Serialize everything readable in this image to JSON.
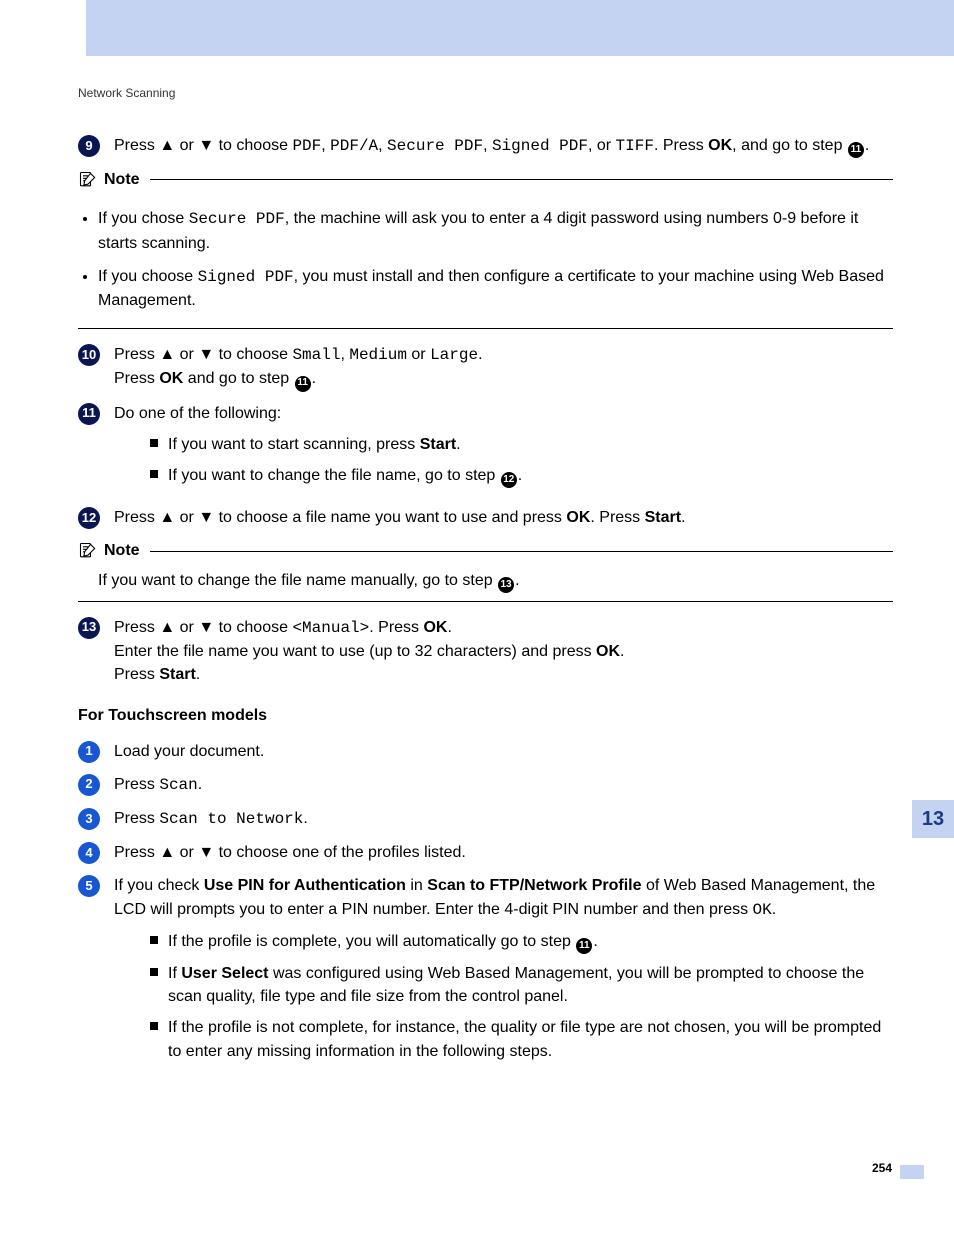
{
  "running_head": "Network Scanning",
  "chapter_tab": "13",
  "page_number": "254",
  "step9": {
    "num": "9",
    "pre1": "Press ",
    "up": "▲",
    "or1": " or ",
    "down": "▼",
    "mid": " to choose ",
    "opt1": "PDF",
    "c1": ", ",
    "opt2": "PDF/A",
    "c2": ", ",
    "opt3": "Secure PDF",
    "c3": ", ",
    "opt4": "Signed PDF",
    "c4": ", or ",
    "opt5": "TIFF",
    "post1": ". Press ",
    "ok": "OK",
    "post2": ", and go to step ",
    "ref": "11",
    "period": "."
  },
  "note1": {
    "label": "Note",
    "b1a": "If you chose ",
    "b1mono": "Secure PDF",
    "b1b": ", the machine will ask you to enter a 4 digit password using numbers 0-9 before it starts scanning.",
    "b2a": "If you choose ",
    "b2mono": "Signed PDF",
    "b2b": ", you must install and then configure a certificate to your machine using Web Based Management."
  },
  "step10": {
    "num": "10",
    "pre": "Press ",
    "up": "▲",
    "or": " or ",
    "down": "▼",
    "mid": " to choose ",
    "o1": "Small",
    "c1": ", ",
    "o2": "Medium",
    "c2": " or ",
    "o3": "Large",
    "p1": ".",
    "l2a": "Press ",
    "l2ok": "OK",
    "l2b": " and go to step ",
    "ref": "11",
    "period": "."
  },
  "step11": {
    "num": "11",
    "line1": "Do one of the following:",
    "s1a": "If you want to start scanning, press ",
    "s1b": "Start",
    "s1c": ".",
    "s2a": "If you want to change the file name, go to step ",
    "s2ref": "12",
    "s2c": "."
  },
  "step12": {
    "num": "12",
    "pre": "Press ",
    "up": "▲",
    "or": " or ",
    "down": "▼",
    "mid": " to choose a file name you want to use and press ",
    "ok": "OK",
    "post1": ". Press ",
    "start": "Start",
    "post2": "."
  },
  "note2": {
    "label": "Note",
    "text1": "If you want to change the file name manually, go to step ",
    "ref": "13",
    "period": "."
  },
  "step13": {
    "num": "13",
    "pre": "Press ",
    "up": "▲",
    "or": " or ",
    "down": "▼",
    "mid": " to choose ",
    "mono": "<Manual>",
    "post1": ". Press ",
    "ok": "OK",
    "post2": ".",
    "l2a": "Enter the file name you want to use (up to 32 characters) and press ",
    "l2ok": "OK",
    "l2p": ".",
    "l3a": "Press ",
    "l3b": "Start",
    "l3c": "."
  },
  "ts_title": "For Touchscreen models",
  "t1": {
    "num": "1",
    "text": "Load your document."
  },
  "t2": {
    "num": "2",
    "pre": "Press ",
    "mono": "Scan",
    "post": "."
  },
  "t3": {
    "num": "3",
    "pre": "Press ",
    "mono": "Scan to Network",
    "post": "."
  },
  "t4": {
    "num": "4",
    "pre": "Press ",
    "up": "▲",
    "or": " or ",
    "down": "▼",
    "post": " to choose one of the profiles listed."
  },
  "t5": {
    "num": "5",
    "a": "If you check ",
    "b": "Use PIN for Authentication",
    "c": " in ",
    "d": "Scan to FTP/Network Profile",
    "e": " of Web Based Management, the LCD will prompts you to enter a PIN number. Enter the 4-digit PIN number and then press ",
    "mono": "OK",
    "f": ".",
    "s1a": "If the profile is complete, you will automatically go to step ",
    "s1ref": "11",
    "s1p": ".",
    "s2a": "If ",
    "s2b": "User Select",
    "s2c": " was configured using Web Based Management, you will be prompted to choose the scan quality, file type and file size from the control panel.",
    "s3": "If the profile is not complete, for instance, the quality or file type are not chosen, you will be prompted to enter any missing information in the following steps."
  }
}
